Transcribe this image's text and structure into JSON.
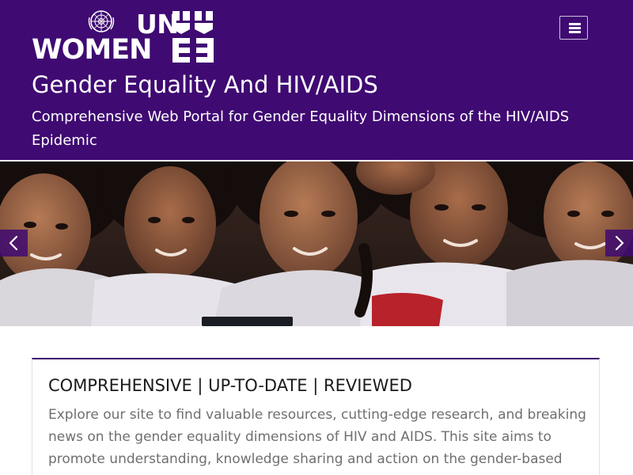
{
  "header": {
    "logo": {
      "line1": "UN",
      "line2": "WOMEN"
    },
    "menu_toggle": {
      "icon": "hamburger-menu-icon"
    },
    "title": "Gender Equality And HIV/AIDS",
    "tagline": "Comprehensive Web Portal for Gender Equality Dimensions of the HIV/AIDS Epidemic"
  },
  "carousel": {
    "prev_icon": "chevron-left-icon",
    "next_icon": "chevron-right-icon"
  },
  "intro": {
    "heading": "COMPREHENSIVE | UP-TO-DATE | REVIEWED",
    "body": "Explore our site to find valuable resources, cutting-edge research, and breaking news on the gender equality dimensions of HIV and AIDS. This site aims to promote understanding, knowledge sharing and action on the gender-based inequalities, as well as the sexual harassment"
  },
  "colors": {
    "brand_purple": "#3f0a72",
    "body_text": "#6f6f6f",
    "heading_text": "#1a1a1a"
  }
}
